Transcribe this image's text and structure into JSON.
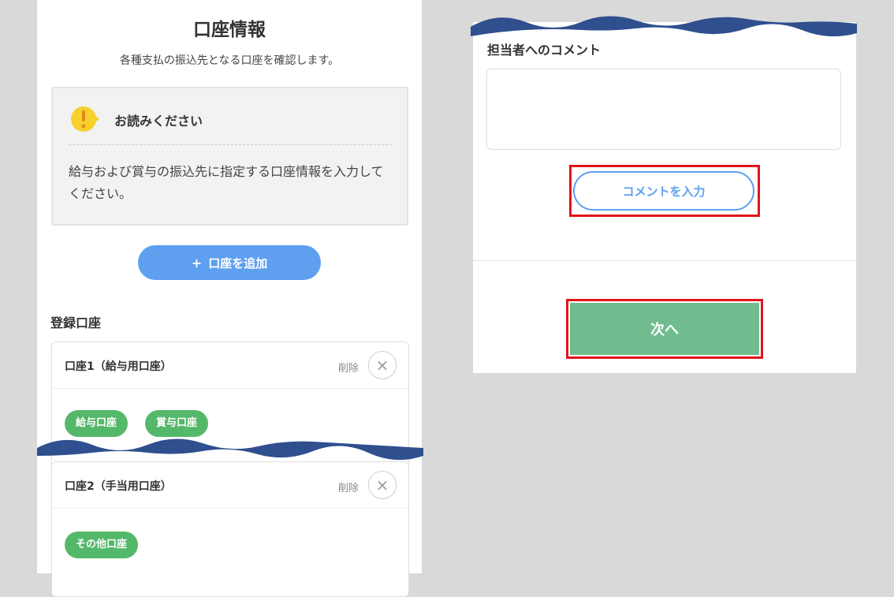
{
  "left_panel": {
    "title": "口座情報",
    "subtitle": "各種支払の振込先となる口座を確認します。",
    "notice": {
      "icon": "warning-icon",
      "title": "お読みください",
      "body": "給与および賞与の振込先に指定する口座情報を入力してください。"
    },
    "add_button": {
      "icon": "+",
      "label": "口座を追加"
    },
    "section_heading": "登録口座",
    "accounts": [
      {
        "name": "口座1（給与用口座）",
        "delete_label": "削除",
        "delete_icon": "×",
        "tags": [
          "給与口座",
          "賞与口座"
        ]
      },
      {
        "name": "口座2（手当用口座）",
        "delete_label": "削除",
        "delete_icon": "×",
        "tags": [
          "その他口座"
        ]
      }
    ]
  },
  "right_panel": {
    "comment_label": "担当者へのコメント",
    "comment_value": "",
    "comment_button": "コメントを入力",
    "next_button": "次へ"
  },
  "colors": {
    "background": "#d9d9d9",
    "primary_blue": "#5e9ff0",
    "tag_green": "#54b86a",
    "next_green": "#70bc8e",
    "highlight_red": "#e2141c",
    "warning_yellow": "#f7d02c",
    "wave_navy": "#2f4f8e"
  }
}
